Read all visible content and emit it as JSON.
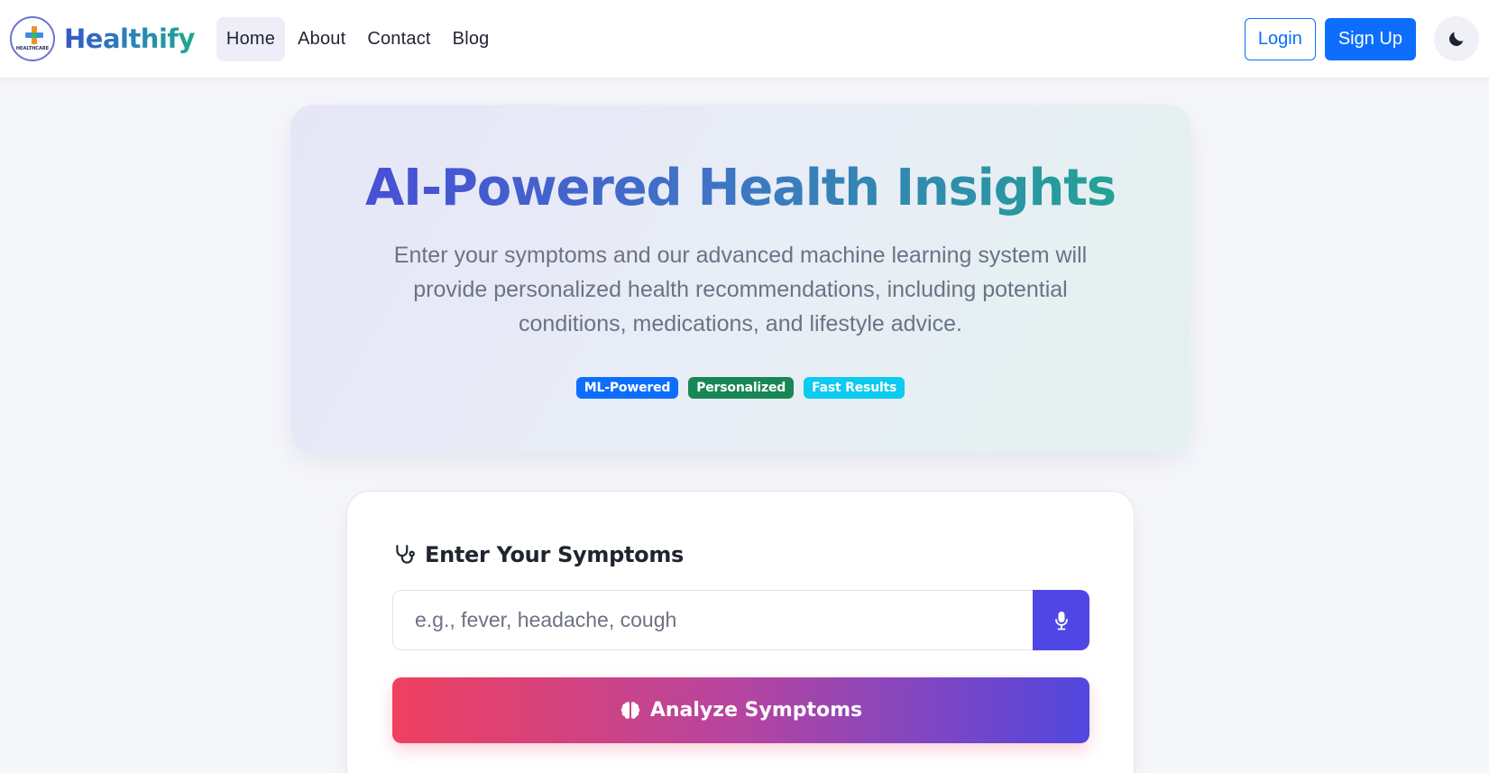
{
  "brand": {
    "name": "Healthify",
    "logo_text": "HEALTHCARE",
    "logo_icon": "medical-cross-logo"
  },
  "nav": {
    "items": [
      {
        "label": "Home",
        "active": true
      },
      {
        "label": "About",
        "active": false
      },
      {
        "label": "Contact",
        "active": false
      },
      {
        "label": "Blog",
        "active": false
      }
    ],
    "login_label": "Login",
    "signup_label": "Sign Up",
    "theme_icon": "moon-icon"
  },
  "hero": {
    "title": "AI-Powered Health Insights",
    "subtitle": "Enter your symptoms and our advanced machine learning system will provide personalized health recommendations, including potential conditions, medications, and lifestyle advice.",
    "badges": [
      {
        "label": "ML-Powered",
        "color": "#0d6efd"
      },
      {
        "label": "Personalized",
        "color": "#198754"
      },
      {
        "label": "Fast Results",
        "color": "#0dcaf0"
      }
    ]
  },
  "symptom_form": {
    "title": "Enter Your Symptoms",
    "title_icon": "stethoscope-icon",
    "input_value": "",
    "input_placeholder": "e.g., fever, headache, cough",
    "mic_icon": "microphone-icon",
    "analyze_label": "Analyze Symptoms",
    "analyze_icon": "brain-icon"
  },
  "colors": {
    "primary": "#0d6efd",
    "accent": "#4f46e5",
    "gradient_start": "#f0405f",
    "gradient_end": "#5147df"
  }
}
